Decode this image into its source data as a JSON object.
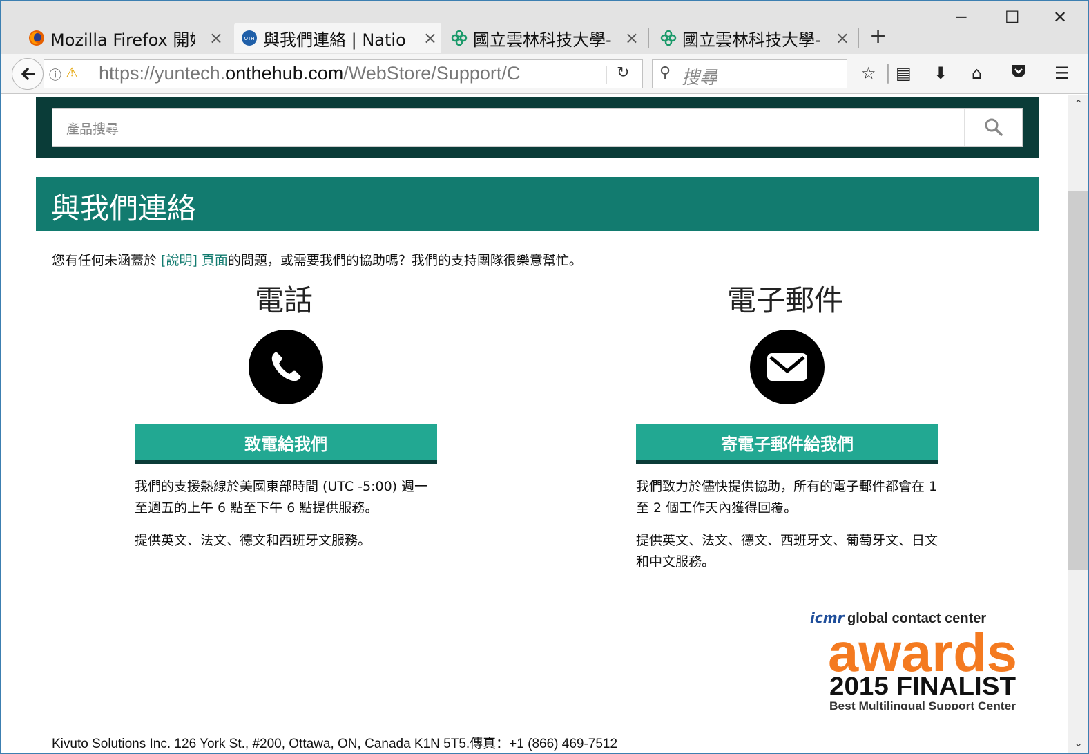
{
  "browser": {
    "tabs": [
      {
        "title": "Mozilla Firefox 開始",
        "active": false
      },
      {
        "title": "與我們連絡 | Natio",
        "active": true
      },
      {
        "title": "國立雲林科技大學-",
        "active": false
      },
      {
        "title": "國立雲林科技大學-",
        "active": false
      }
    ],
    "close_glyph": "×",
    "new_tab": "+",
    "window_controls": {
      "minimize": "─",
      "maximize": "☐",
      "close": "✕"
    },
    "url_prefix": "https://yuntech.",
    "url_host": "onthehub.com",
    "url_path": "/WebStore/Support/C",
    "search_placeholder": "搜尋",
    "icons": [
      "back-arrow-icon",
      "info-icon",
      "warning-lock-icon",
      "reload-icon",
      "search-icon",
      "bookmark-star-icon",
      "reading-list-icon",
      "download-icon",
      "home-icon",
      "pocket-icon",
      "menu-icon"
    ]
  },
  "page": {
    "product_search_placeholder": "產品搜尋",
    "header_title": "與我們連絡",
    "intro_before": "您有任何未涵蓋於 ",
    "intro_link": "[說明] 頁面",
    "intro_after": "的問題，或需要我們的協助嗎？我們的支持團隊很樂意幫忙。",
    "phone": {
      "title": "電話",
      "button": "致電給我們",
      "desc1": "我們的支援熱線於美國東部時間 (UTC -5:00) 週一至週五的上午 6 點至下午 6 點提供服務。",
      "desc2": "提供英文、法文、德文和西班牙文服務。"
    },
    "email": {
      "title": "電子郵件",
      "button": "寄電子郵件給我們",
      "desc1": "我們致力於儘快提供協助，所有的電子郵件都會在 1 至 2 個工作天內獲得回覆。",
      "desc2": "提供英文、法文、德文、西班牙文、葡萄牙文、日文和中文服務。"
    },
    "award": {
      "brand": "icmr",
      "line1": "global contact center",
      "line2": "awards",
      "line3": "2015 FINALIST",
      "line4": "Best Multilingual Support Center"
    },
    "footer": "Kivuto Solutions Inc. 126 York St., #200, Ottawa, ON, Canada K1N 5T5.傳真：+1 (866) 469-7512"
  },
  "colors": {
    "header_green": "#127b6f",
    "button_green": "#22a892",
    "dark_band": "#0a3c38",
    "award_orange": "#f47a20"
  }
}
